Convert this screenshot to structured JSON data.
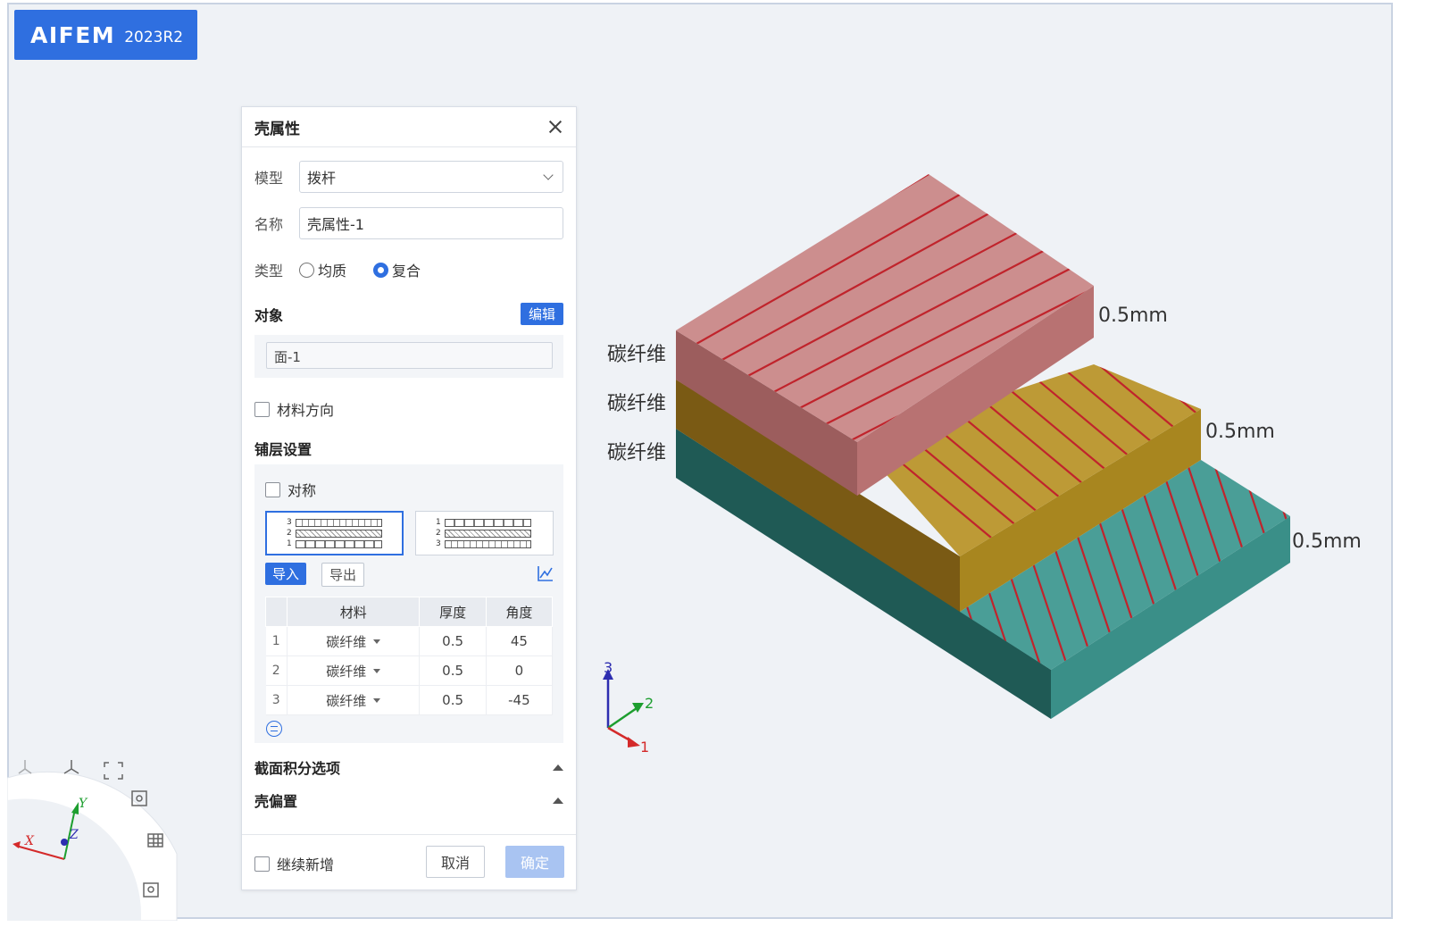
{
  "brand": {
    "name": "AIFEM",
    "version": "2023R2"
  },
  "dialog": {
    "title": "壳属性",
    "model": {
      "label": "模型",
      "value": "拨杆"
    },
    "name": {
      "label": "名称",
      "value": "壳属性-1"
    },
    "type": {
      "label": "类型",
      "options": [
        "均质",
        "复合"
      ],
      "selected": "复合"
    },
    "target": {
      "label": "对象",
      "edit_label": "编辑",
      "value": "面-1"
    },
    "material_direction": {
      "label": "材料方向",
      "checked": false
    },
    "layup": {
      "title": "铺层设置",
      "symmetric_label": "对称",
      "sequence_top_first": [
        "3",
        "2",
        "1"
      ],
      "sequence_bottom_first": [
        "1",
        "2",
        "3"
      ],
      "import_label": "导入",
      "export_label": "导出",
      "columns": [
        "材料",
        "厚度",
        "角度"
      ],
      "rows": [
        {
          "index": "1",
          "material": "碳纤维",
          "thickness": "0.5",
          "angle": "45"
        },
        {
          "index": "2",
          "material": "碳纤维",
          "thickness": "0.5",
          "angle": "0"
        },
        {
          "index": "3",
          "material": "碳纤维",
          "thickness": "0.5",
          "angle": "-45"
        }
      ]
    },
    "integration_label": "截面积分选项",
    "offset_label": "壳偏置",
    "continue_label": "继续新增",
    "cancel_label": "取消",
    "ok_label": "确定"
  },
  "model_view": {
    "layer_labels": [
      "碳纤维",
      "碳纤维",
      "碳纤维"
    ],
    "thickness_labels": [
      "0.5mm",
      "0.5mm",
      "0.5mm"
    ],
    "layer_colors": {
      "top": "#c98a8a",
      "middle": "#b8962f",
      "bottom": "#3f918a",
      "fiber": "#c0242c"
    }
  },
  "triad": {
    "axis1": "1",
    "axis2": "2",
    "axis3": "3"
  },
  "navcube": {
    "x": "X",
    "y": "Y",
    "z": "Z"
  }
}
